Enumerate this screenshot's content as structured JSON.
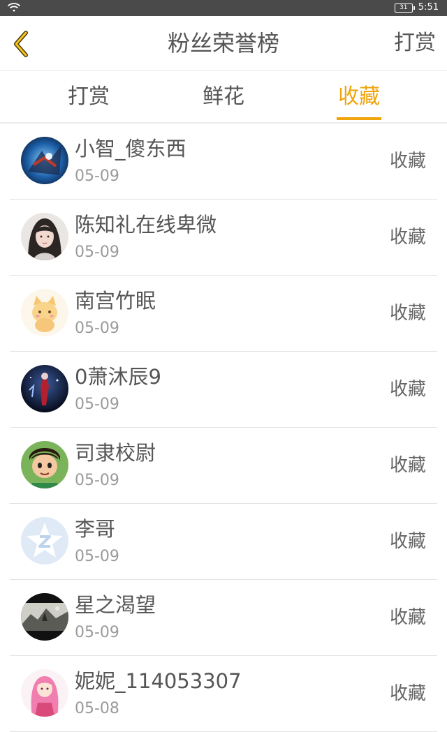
{
  "status_bar": {
    "battery": "31",
    "time": "5:51",
    "icons": [
      "wifi-icon",
      "battery-icon"
    ]
  },
  "header": {
    "back_icon": "chevron-left-icon",
    "title": "粉丝荣誉榜",
    "right_action": "打赏",
    "accent_color": "#f0a30a"
  },
  "tabs": [
    {
      "label": "打赏",
      "active": false
    },
    {
      "label": "鲜花",
      "active": false
    },
    {
      "label": "收藏",
      "active": true
    }
  ],
  "fans": [
    {
      "name": "小智_傻东西",
      "date": "05-09",
      "action": "收藏",
      "avatar": "avatar-robot-blue"
    },
    {
      "name": "陈知礼在线卑微",
      "date": "05-09",
      "action": "收藏",
      "avatar": "avatar-girl-photo"
    },
    {
      "name": "南宫竹眠",
      "date": "05-09",
      "action": "收藏",
      "avatar": "avatar-cartoon-cat"
    },
    {
      "name": "0萧沐辰9",
      "date": "05-09",
      "action": "收藏",
      "avatar": "avatar-dark-figure"
    },
    {
      "name": "司隶校尉",
      "date": "05-09",
      "action": "收藏",
      "avatar": "avatar-cartoon-boy"
    },
    {
      "name": "李哥",
      "date": "05-09",
      "action": "收藏",
      "avatar": "avatar-default-star"
    },
    {
      "name": "星之渴望",
      "date": "05-09",
      "action": "收藏",
      "avatar": "avatar-ink-landscape"
    },
    {
      "name": "妮妮_114053307",
      "date": "05-08",
      "action": "收藏",
      "avatar": "avatar-anime-girl"
    }
  ]
}
